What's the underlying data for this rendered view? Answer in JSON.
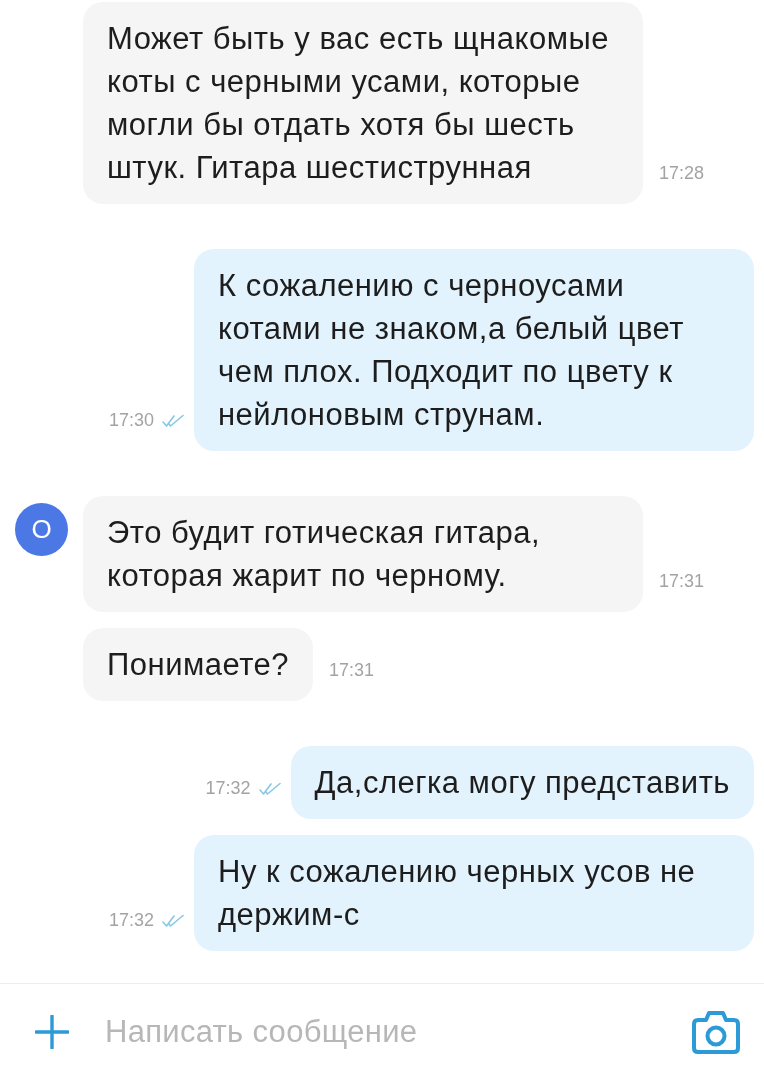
{
  "messages": [
    {
      "kind": "incoming",
      "text": "Может быть у вас есть щнакомые коты с черными усами, которые могли бы отдать хотя бы шесть штук. Гитара шестиструнная",
      "time": "17:28"
    },
    {
      "kind": "outgoing",
      "text": "К сожалению с черноусами котами не знаком,а белый цвет чем плох. Подходит по цвету к нейлоновым струнам.",
      "time": "17:30",
      "read": true
    },
    {
      "kind": "incoming",
      "avatar": "О",
      "text": "Это будит готическая гитара, которая жарит по черному.",
      "time": "17:31"
    },
    {
      "kind": "incoming",
      "text": "Понимаете?",
      "time": "17:31"
    },
    {
      "kind": "outgoing",
      "text": "Да,слегка могу представить",
      "time": "17:32",
      "read": true
    },
    {
      "kind": "outgoing",
      "text": "Ну к сожалению черных усов не держим-с",
      "time": "17:32",
      "read": true
    }
  ],
  "composer": {
    "placeholder": "Написать сообщение"
  }
}
